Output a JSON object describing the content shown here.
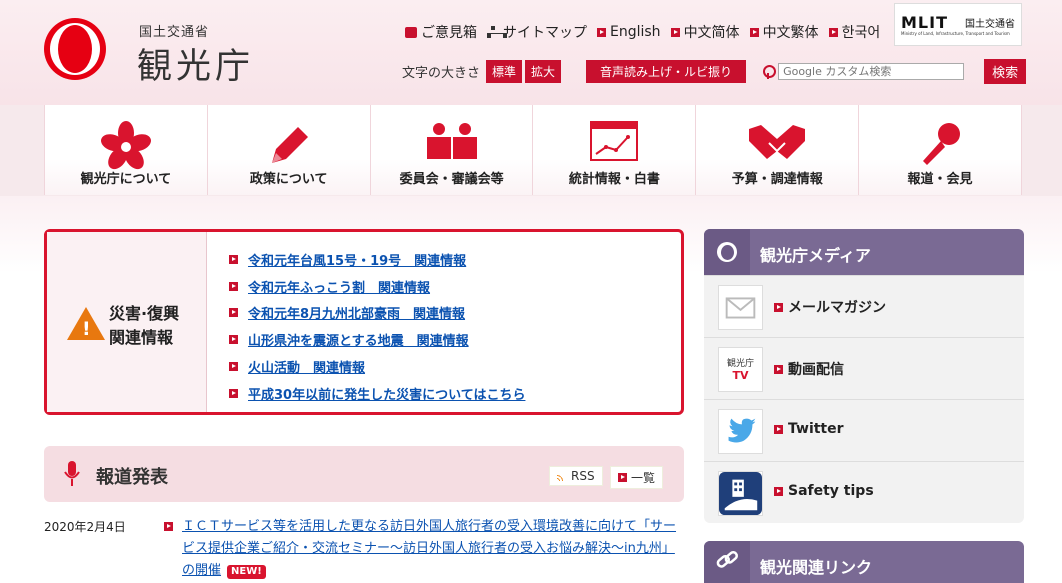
{
  "header": {
    "logo_sub": "国土交通省",
    "logo_main": "観光庁",
    "links": [
      {
        "label": "ご意見箱",
        "icon": "mailbox-icon"
      },
      {
        "label": "サイトマップ",
        "icon": "sitemap-icon"
      },
      {
        "label": "English",
        "icon": "arrow-square-icon"
      },
      {
        "label": "中文简体",
        "icon": "arrow-square-icon"
      },
      {
        "label": "中文繁体",
        "icon": "arrow-square-icon"
      },
      {
        "label": "한국어",
        "icon": "arrow-square-icon"
      }
    ],
    "mlit_logo": "MLIT",
    "mlit_jp": "国土交通省",
    "mlit_en": "Ministry of Land, Infrastructure, Transport and Tourism",
    "font_size_label": "文字の大きさ",
    "font_standard": "標準",
    "font_large": "拡大",
    "voice_label": "音声読み上げ・ルビ振り",
    "search_placeholder": "Google カスタム検索",
    "search_button": "検索"
  },
  "nav": [
    {
      "label": "観光庁について",
      "icon": "cherry-blossom-icon"
    },
    {
      "label": "政策について",
      "icon": "pencil-icon"
    },
    {
      "label": "委員会・審議会等",
      "icon": "people-icon"
    },
    {
      "label": "統計情報・白書",
      "icon": "chart-icon"
    },
    {
      "label": "予算・調達情報",
      "icon": "handshake-icon"
    },
    {
      "label": "報道・会見",
      "icon": "microphone-icon"
    }
  ],
  "disaster": {
    "title_line1": "災害·復興",
    "title_line2": "関連情報",
    "items": [
      "令和元年台風15号・19号　関連情報",
      "令和元年ふっこう割　関連情報",
      "令和元年8月九州北部豪雨　関連情報",
      "山形県沖を震源とする地震　関連情報",
      "火山活動　関連情報",
      "平成30年以前に発生した災害についてはこちら"
    ]
  },
  "press": {
    "title": "報道発表",
    "rss_label": "RSS",
    "list_label": "一覧"
  },
  "news": [
    {
      "date": "2020年2月4日",
      "text": "ＩＣＴサービス等を活用した更なる訪日外国人旅行者の受入環境改善に向けて「サービス提供企業ご紹介・交流セミナー～訪日外国人旅行者の受入お悩み解決～in九州」の開催",
      "badge": "NEW!"
    }
  ],
  "media": {
    "title": "観光庁メディア",
    "items": [
      {
        "label": "メールマガジン",
        "icon": "envelope-icon"
      },
      {
        "label": "動画配信",
        "icon": "tv-icon",
        "thumb_text_1": "観光庁",
        "thumb_text_2": "TV"
      },
      {
        "label": "Twitter",
        "icon": "twitter-bird-icon"
      },
      {
        "label": "Safety tips",
        "icon": "safety-tips-icon"
      }
    ]
  },
  "links_panel": {
    "title": "観光関連リンク"
  },
  "colors": {
    "brand_red": "#c8102e",
    "panel_purple": "#7a6a94",
    "link_blue": "#0b52b0",
    "warning_orange": "#e8780f"
  }
}
